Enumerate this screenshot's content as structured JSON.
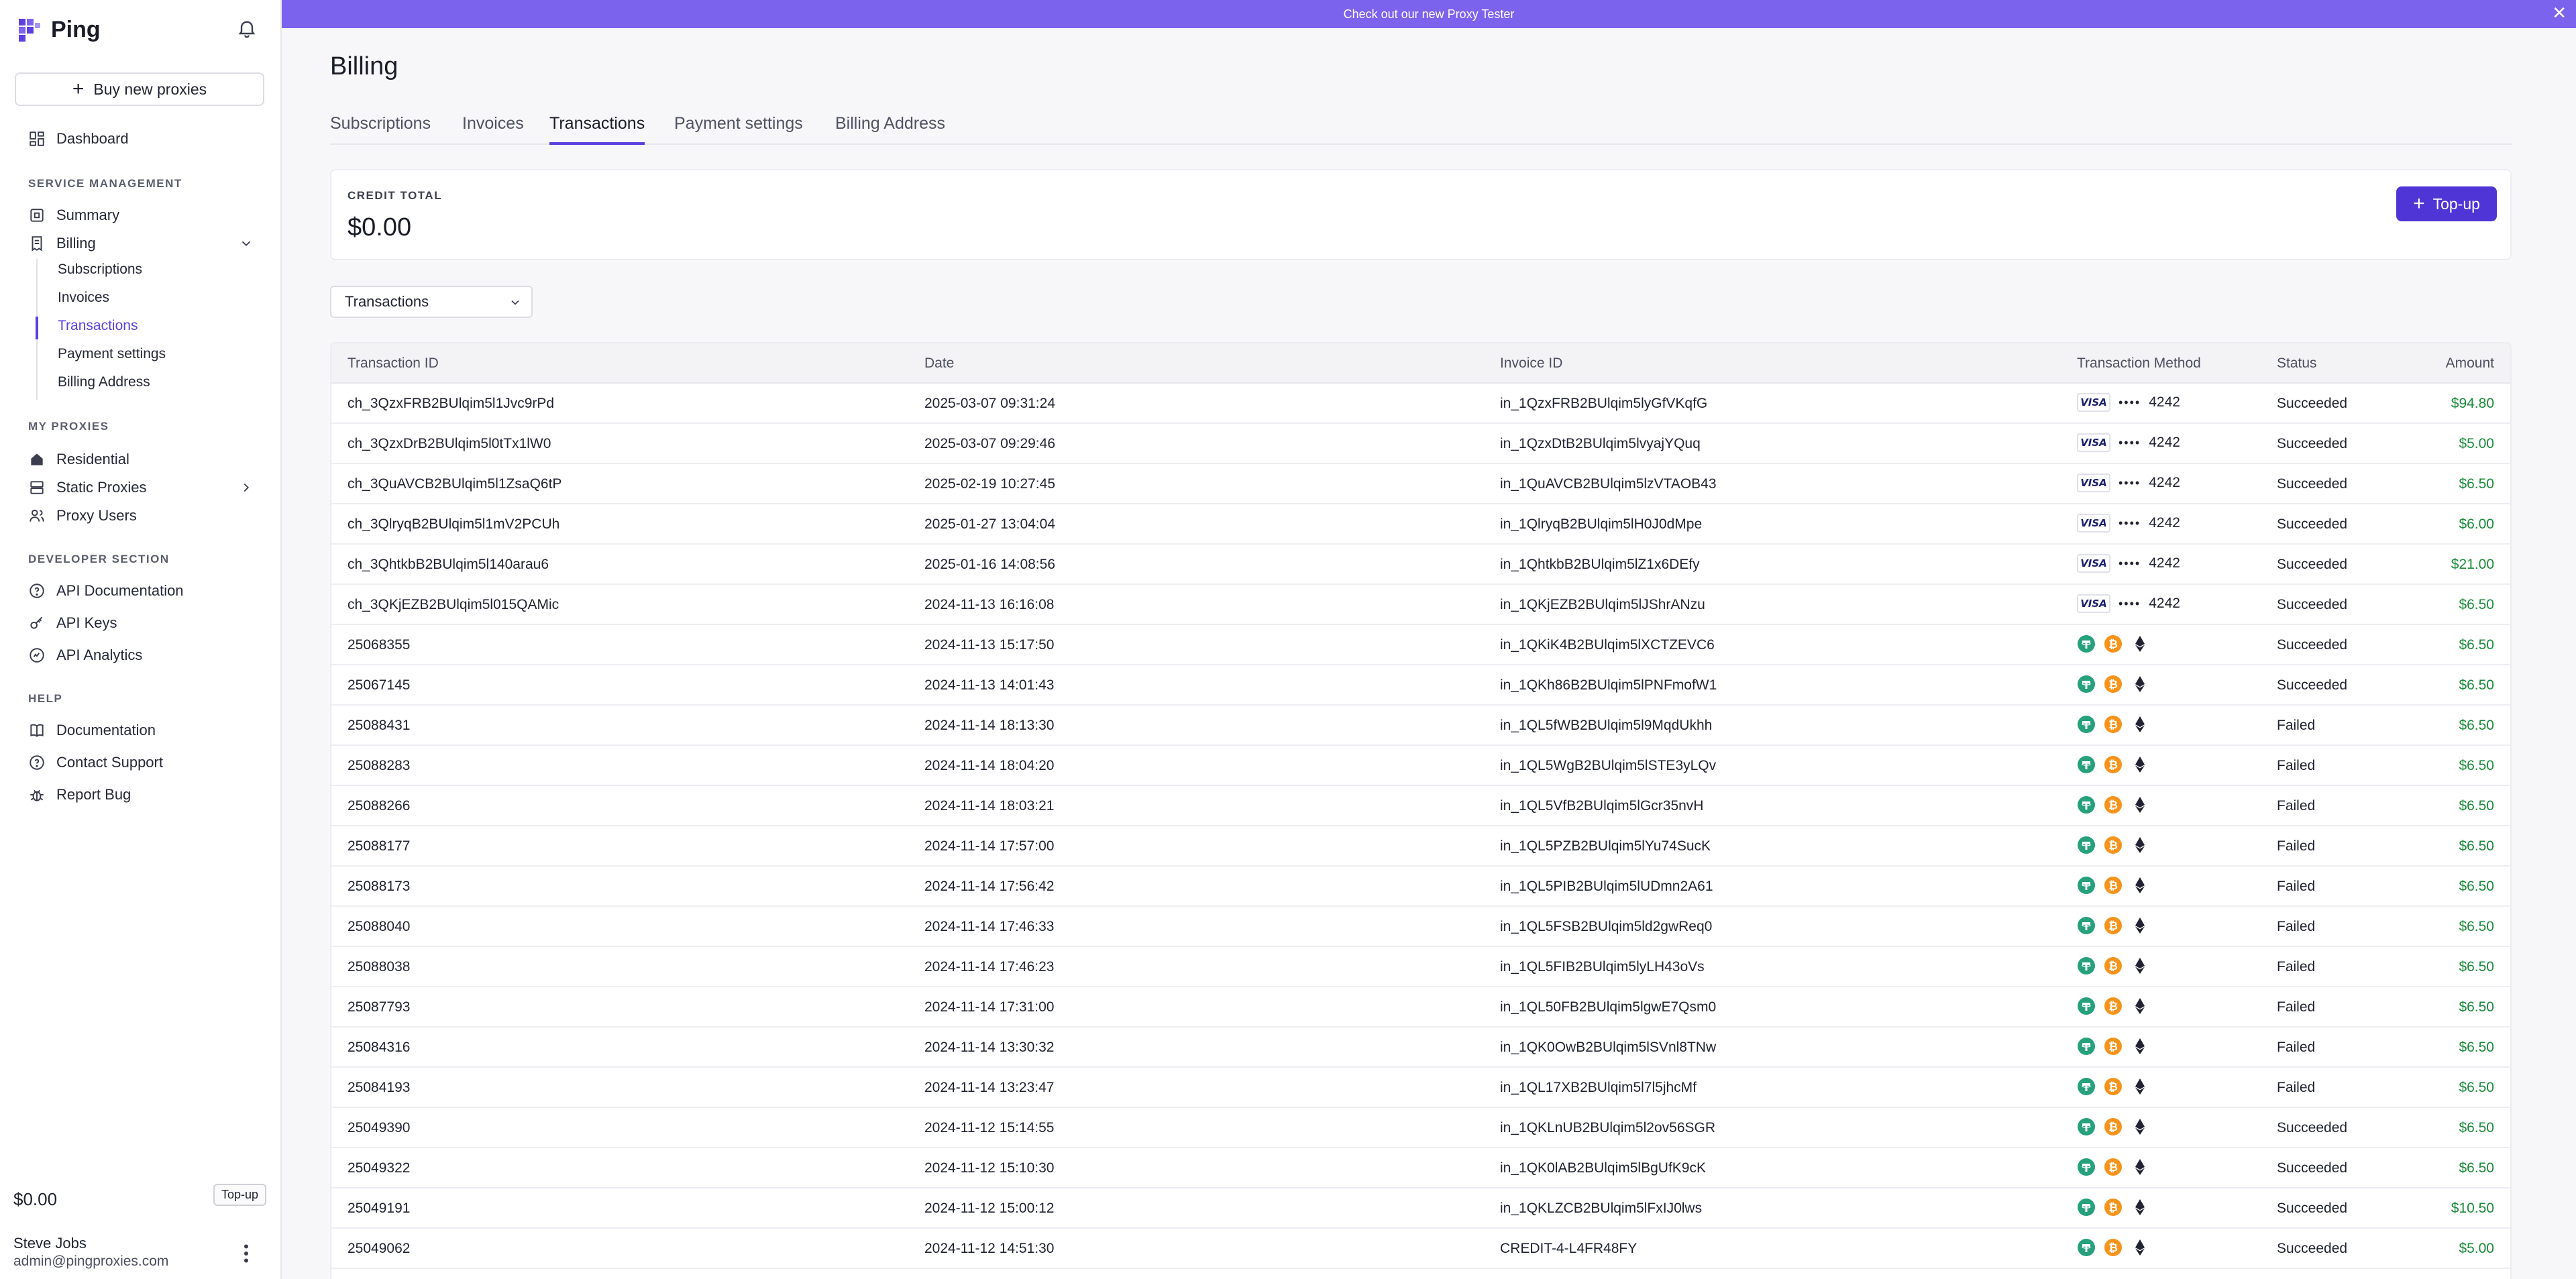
{
  "app": {
    "name": "Ping"
  },
  "banner": {
    "text": "Check out our new Proxy Tester",
    "close": "✕"
  },
  "sidebar": {
    "buy_button": "Buy new proxies",
    "dashboard": "Dashboard",
    "sections": {
      "service": "SERVICE MANAGEMENT",
      "proxies": "MY PROXIES",
      "developer": "DEVELOPER SECTION",
      "help": "HELP"
    },
    "service_items": {
      "summary": "Summary",
      "billing": "Billing"
    },
    "billing_sub": [
      "Subscriptions",
      "Invoices",
      "Transactions",
      "Payment settings",
      "Billing Address"
    ],
    "proxy_items": {
      "residential": "Residential",
      "static": "Static Proxies",
      "users": "Proxy Users"
    },
    "developer_items": {
      "docs": "API Documentation",
      "keys": "API Keys",
      "analytics": "API Analytics"
    },
    "help_items": {
      "documentation": "Documentation",
      "support": "Contact Support",
      "bug": "Report Bug"
    },
    "footer": {
      "balance": "$0.00",
      "topup": "Top-up",
      "name": "Steve Jobs",
      "email": "admin@pingproxies.com"
    }
  },
  "page": {
    "title": "Billing",
    "tabs": [
      "Subscriptions",
      "Invoices",
      "Transactions",
      "Payment settings",
      "Billing Address"
    ],
    "active_tab": "Transactions",
    "credit": {
      "label": "CREDIT TOTAL",
      "value": "$0.00",
      "topup": "Top-up"
    },
    "filter": {
      "selected": "Transactions"
    }
  },
  "table": {
    "headers": [
      "Transaction ID",
      "Date",
      "Invoice ID",
      "Transaction Method",
      "Status",
      "Amount"
    ],
    "rows": [
      {
        "id": "ch_3QzxFRB2BUlqim5l1Jvc9rPd",
        "date": "2025-03-07 09:31:24",
        "invoice": "in_1QzxFRB2BUlqim5lyGfVKqfG",
        "method": "card",
        "card_brand": "VISA",
        "last4": "4242",
        "status": "Succeeded",
        "amount": "$94.80"
      },
      {
        "id": "ch_3QzxDrB2BUlqim5l0tTx1lW0",
        "date": "2025-03-07 09:29:46",
        "invoice": "in_1QzxDtB2BUlqim5lvyajYQuq",
        "method": "card",
        "card_brand": "VISA",
        "last4": "4242",
        "status": "Succeeded",
        "amount": "$5.00"
      },
      {
        "id": "ch_3QuAVCB2BUlqim5l1ZsaQ6tP",
        "date": "2025-02-19 10:27:45",
        "invoice": "in_1QuAVCB2BUlqim5lzVTAOB43",
        "method": "card",
        "card_brand": "VISA",
        "last4": "4242",
        "status": "Succeeded",
        "amount": "$6.50"
      },
      {
        "id": "ch_3QlryqB2BUlqim5l1mV2PCUh",
        "date": "2025-01-27 13:04:04",
        "invoice": "in_1QlryqB2BUlqim5lH0J0dMpe",
        "method": "card",
        "card_brand": "VISA",
        "last4": "4242",
        "status": "Succeeded",
        "amount": "$6.00"
      },
      {
        "id": "ch_3QhtkbB2BUlqim5l140arau6",
        "date": "2025-01-16 14:08:56",
        "invoice": "in_1QhtkbB2BUlqim5lZ1x6DEfy",
        "method": "card",
        "card_brand": "VISA",
        "last4": "4242",
        "status": "Succeeded",
        "amount": "$21.00"
      },
      {
        "id": "ch_3QKjEZB2BUlqim5l015QAMic",
        "date": "2024-11-13 16:16:08",
        "invoice": "in_1QKjEZB2BUlqim5lJShrANzu",
        "method": "card",
        "card_brand": "VISA",
        "last4": "4242",
        "status": "Succeeded",
        "amount": "$6.50"
      },
      {
        "id": "25068355",
        "date": "2024-11-13 15:17:50",
        "invoice": "in_1QKiK4B2BUlqim5lXCTZEVC6",
        "method": "crypto",
        "status": "Succeeded",
        "amount": "$6.50"
      },
      {
        "id": "25067145",
        "date": "2024-11-13 14:01:43",
        "invoice": "in_1QKh86B2BUlqim5lPNFmofW1",
        "method": "crypto",
        "status": "Succeeded",
        "amount": "$6.50"
      },
      {
        "id": "25088431",
        "date": "2024-11-14 18:13:30",
        "invoice": "in_1QL5fWB2BUlqim5l9MqdUkhh",
        "method": "crypto",
        "status": "Failed",
        "amount": "$6.50"
      },
      {
        "id": "25088283",
        "date": "2024-11-14 18:04:20",
        "invoice": "in_1QL5WgB2BUlqim5lSTE3yLQv",
        "method": "crypto",
        "status": "Failed",
        "amount": "$6.50"
      },
      {
        "id": "25088266",
        "date": "2024-11-14 18:03:21",
        "invoice": "in_1QL5VfB2BUlqim5lGcr35nvH",
        "method": "crypto",
        "status": "Failed",
        "amount": "$6.50"
      },
      {
        "id": "25088177",
        "date": "2024-11-14 17:57:00",
        "invoice": "in_1QL5PZB2BUlqim5lYu74SucK",
        "method": "crypto",
        "status": "Failed",
        "amount": "$6.50"
      },
      {
        "id": "25088173",
        "date": "2024-11-14 17:56:42",
        "invoice": "in_1QL5PIB2BUlqim5lUDmn2A61",
        "method": "crypto",
        "status": "Failed",
        "amount": "$6.50"
      },
      {
        "id": "25088040",
        "date": "2024-11-14 17:46:33",
        "invoice": "in_1QL5FSB2BUlqim5ld2gwReq0",
        "method": "crypto",
        "status": "Failed",
        "amount": "$6.50"
      },
      {
        "id": "25088038",
        "date": "2024-11-14 17:46:23",
        "invoice": "in_1QL5FIB2BUlqim5lyLH43oVs",
        "method": "crypto",
        "status": "Failed",
        "amount": "$6.50"
      },
      {
        "id": "25087793",
        "date": "2024-11-14 17:31:00",
        "invoice": "in_1QL50FB2BUlqim5lgwE7Qsm0",
        "method": "crypto",
        "status": "Failed",
        "amount": "$6.50"
      },
      {
        "id": "25084316",
        "date": "2024-11-14 13:30:32",
        "invoice": "in_1QK0OwB2BUlqim5lSVnl8TNw",
        "method": "crypto",
        "status": "Failed",
        "amount": "$6.50"
      },
      {
        "id": "25084193",
        "date": "2024-11-14 13:23:47",
        "invoice": "in_1QL17XB2BUlqim5l7l5jhcMf",
        "method": "crypto",
        "status": "Failed",
        "amount": "$6.50"
      },
      {
        "id": "25049390",
        "date": "2024-11-12 15:14:55",
        "invoice": "in_1QKLnUB2BUlqim5l2ov56SGR",
        "method": "crypto",
        "status": "Succeeded",
        "amount": "$6.50"
      },
      {
        "id": "25049322",
        "date": "2024-11-12 15:10:30",
        "invoice": "in_1QK0lAB2BUlqim5lBgUfK9cK",
        "method": "crypto",
        "status": "Succeeded",
        "amount": "$6.50"
      },
      {
        "id": "25049191",
        "date": "2024-11-12 15:00:12",
        "invoice": "in_1QKLZCB2BUlqim5lFxIJ0lws",
        "method": "crypto",
        "status": "Succeeded",
        "amount": "$10.50"
      },
      {
        "id": "25049062",
        "date": "2024-11-12 14:51:30",
        "invoice": "CREDIT-4-L4FR48FY",
        "method": "crypto",
        "status": "Succeeded",
        "amount": "$5.00"
      }
    ]
  },
  "colors": {
    "accent": "#5b3fe0",
    "banner": "#7b63ee",
    "amount": "#1a8a3a",
    "tether": "#26a17b",
    "bitcoin": "#f7931a",
    "ethereum": "#1f2230"
  },
  "icons": {
    "card": [
      "visa-card-icon"
    ],
    "crypto": [
      "tether-icon",
      "bitcoin-icon",
      "ethereum-icon"
    ]
  }
}
